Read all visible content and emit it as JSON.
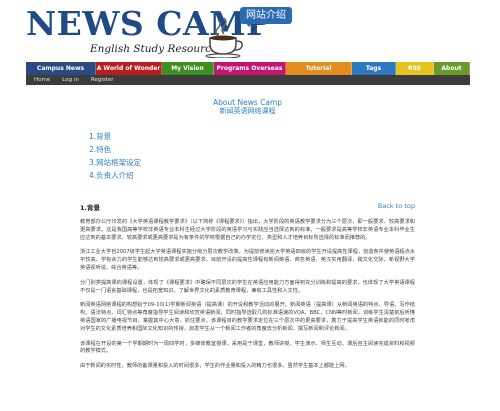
{
  "header": {
    "logo_title": "NEWS CAMP",
    "logo_subtitle": "English Study Resources",
    "bubble_label": "网站介绍"
  },
  "tabs": [
    {
      "label": "Campus News",
      "color": "#2a4a82"
    },
    {
      "label": "A World of Wonder",
      "color": "#b81e1e"
    },
    {
      "label": "My Vision",
      "color": "#3d8f1f"
    },
    {
      "label": "Programs Overseas",
      "color": "#c41472"
    },
    {
      "label": "Tutorial",
      "color": "#e58c1f"
    },
    {
      "label": "Tags",
      "color": "#2e78c2"
    },
    {
      "label": "RSS",
      "color": "#e6c21f"
    },
    {
      "label": "About",
      "color": "#6a9a2a"
    }
  ],
  "subnav": {
    "home": "Home",
    "login": "Log in",
    "register": "Register"
  },
  "main": {
    "title": "About News Camp",
    "subtitle": "新闻英语网络课程",
    "toc": [
      "1.背景",
      "2.特色",
      "3.网站框架设定",
      "4.负责人介绍"
    ],
    "section_title": "1.背景",
    "back_to_top": "Back to top",
    "paragraphs": [
      "教育部办公厅印发的《大学英语课程教学要求》（以下简称《课程要求》）指出，大学阶段的英语教学要求分为三个层次，即一般要求、较高要求和更高要求。这是我国高等学校非英语专业本科生经过大学阶段的英语学习与实践应当选择达到的标准。一般要求是高等学校非英语专业本科毕业生应达到的基本要求。较高要求或更高要求是为有条件的学校根据自己的办学定位、类型和人才培养目标所选择的标准而推荐的。",
      "浙江工业大学自2007级学生起大学英语课程实施分级分层次教学改革。为提前修读完大学英语四级的学生开设提高性课程，创造条件使英语超点水平较高、学有余力的学生能够达到较高要求或更高要求。目前开设的提高性课程有新闻英语、商务英语、英汉实用翻译、跨文化交际、新视野大学英语视听说、综合英语等。",
      "分门别类提高课的课程设置，体现了《课程要求》中确保不同层次的学生在英语应用能力方面得到充分训练和提高的要求，也体现了大学英语课程不仅是一门语言基础课程，也是拓宽知识、了解世界文化的素质教育课程，兼有工具性和人文性。",
      "新闻英语网络课程的构想始于09-10(1)学期新闻英语（提高课）的开设和教学活动的展开。新闻英语（提高课）从新闻英语的特点、导语、写作结构、语法特点、词汇特点等角度指导学生阅读和欣赏英语新闻，同时指导选取几则标准语速的VOA、BBC、CNN等时新闻，训练学生清楚前后听懂英语国家的广播电视节目，掌握其中心大意，抓住要点。该课程目的教学要求定位在三个层次中的更高要求，着力于提高学生英语就能的同时考虑对学生的文化素质培养和国际文化知识的传授，启发学生从一个新闻工作者的角度去分析新闻、撰写新闻和评论新闻。",
      "该课程在开设的第一个学期期时为一周四学时，多媒体教室授课，采用是于课堂，教师讲授、学生演示、师生互动、课后自主阅读完成资料和视频的教学模式。",
      "由于新闻的实时性，教师的备课量和投入的时间很多，学生的作业量和投入的精力也很多。虽然学生基本上都能上网，"
    ]
  }
}
